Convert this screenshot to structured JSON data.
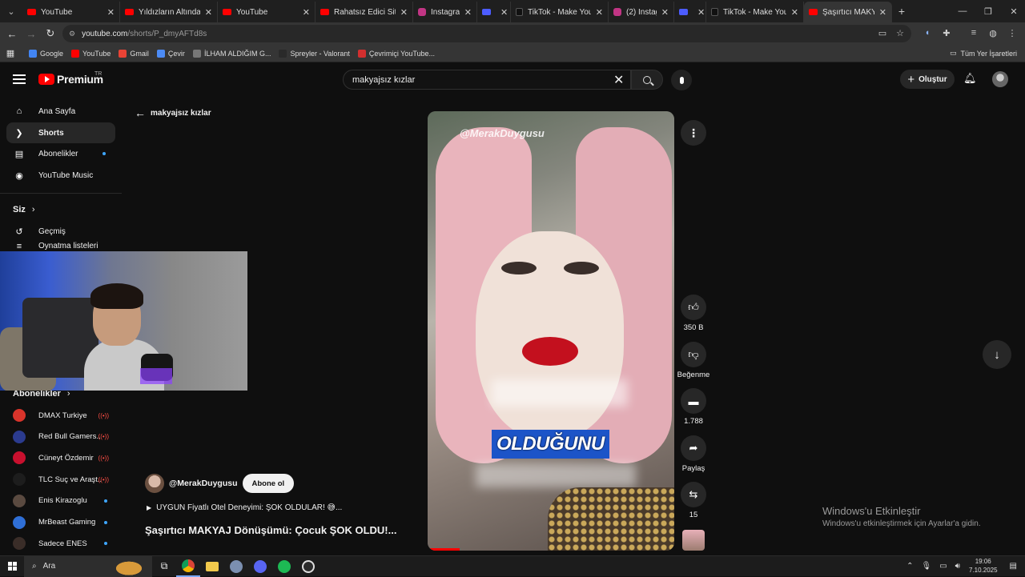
{
  "browser": {
    "tabs": [
      {
        "title": "YouTube",
        "type": "yt",
        "active": false
      },
      {
        "title": "Yıldızların Altında - Se",
        "type": "yt",
        "active": false
      },
      {
        "title": "YouTube",
        "type": "yt",
        "active": false
      },
      {
        "title": "Rahatsız Edici Siteler",
        "type": "yt",
        "active": false
      },
      {
        "title": "Instagram",
        "type": "ig",
        "active": false
      },
      {
        "title": "",
        "type": "misc",
        "active": false
      },
      {
        "title": "TikTok - Make Your D",
        "type": "tt",
        "active": false
      },
      {
        "title": "(2) Instagram",
        "type": "ig",
        "active": false
      },
      {
        "title": "",
        "type": "misc",
        "active": false
      },
      {
        "title": "TikTok - Make Your D",
        "type": "tt",
        "active": false
      },
      {
        "title": "Şaşırtıcı MAKYAJ",
        "type": "yt",
        "active": true
      }
    ],
    "url_host": "youtube.com",
    "url_path": "/shorts/P_dmyAFTd8s",
    "bookmarks": [
      {
        "label": "Google",
        "color": "#4285f4"
      },
      {
        "label": "YouTube",
        "color": "#ff0000"
      },
      {
        "label": "Gmail",
        "color": "#ea4335"
      },
      {
        "label": "Çevir",
        "color": "#4c8bf5"
      },
      {
        "label": "İLHAM ALDIĞIM G...",
        "color": "#777777"
      },
      {
        "label": "Spreyler - Valorant",
        "color": "#2a2a2a"
      },
      {
        "label": "Çevrimiçi YouTube...",
        "color": "#d32f2f"
      }
    ],
    "all_bookmarks": "Tüm Yer İşaretleri"
  },
  "yt": {
    "logo_text": "Premium",
    "logo_badge": "TR",
    "search_query": "makyajsız kızlar",
    "create_label": "Oluştur",
    "sidebar": {
      "items": [
        {
          "label": "Ana Sayfa",
          "icon": "home-icon",
          "glyph": "⌂"
        },
        {
          "label": "Shorts",
          "icon": "shorts-icon",
          "glyph": "❯"
        },
        {
          "label": "Abonelikler",
          "icon": "subscriptions-icon",
          "glyph": "▤"
        },
        {
          "label": "YouTube Music",
          "icon": "music-icon",
          "glyph": "◉"
        }
      ],
      "you_heading": "Siz",
      "history_label": "Geçmiş",
      "playlists_label": "Oynatma listeleri",
      "subs_heading": "Abonelikler",
      "subscriptions": [
        {
          "name": "DMAX Turkiye",
          "color": "#d9342b",
          "status": "live"
        },
        {
          "name": "Red Bull Gamers...",
          "color": "#2b3b8f",
          "status": "live"
        },
        {
          "name": "Cüneyt Özdemir",
          "color": "#c8102e",
          "status": "live"
        },
        {
          "name": "TLC Suç ve Araşt...",
          "color": "#1d1d1d",
          "status": "live"
        },
        {
          "name": "Enis Kirazoglu",
          "color": "#5a4a40",
          "status": "new"
        },
        {
          "name": "MrBeast Gaming",
          "color": "#2f6fd6",
          "status": "new"
        },
        {
          "name": "Sadece ENES",
          "color": "#3a2d28",
          "status": "new"
        }
      ],
      "live_glyph": "((•))"
    },
    "back_label": "makyajsız kızlar",
    "short": {
      "watermark": "@MerakDuygusu",
      "caption": "OLDUĞUNU",
      "progress": 0.13,
      "channel": "@MerakDuygusu",
      "subscribe_label": "Abone ol",
      "sound_text": "UYGUN Fiyatlı Otel Deneyimi: ŞOK OLDULAR! 😅...",
      "title": "Şaşırtıcı MAKYAJ Dönüşümü: Çocuk ŞOK OLDU!...",
      "likes": "350 B",
      "dislike_label": "Beğenme",
      "comments": "1.788",
      "share_label": "Paylaş",
      "remix_count": "15"
    },
    "activation": {
      "title": "Windows'u Etkinleştir",
      "subtitle": "Windows'u etkinleştirmek için Ayarlar'a gidin."
    }
  },
  "taskbar": {
    "search_placeholder": "Ara",
    "time": "19:06",
    "date": "7.10.2025"
  }
}
